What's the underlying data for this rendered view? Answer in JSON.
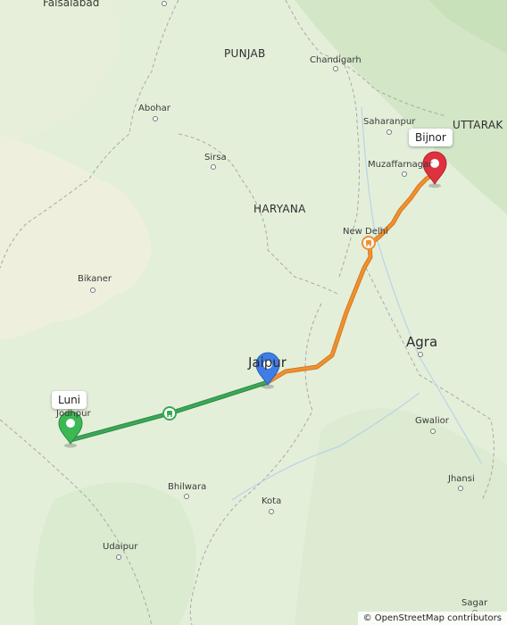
{
  "map": {
    "labels": {
      "faisalabad": "Faisalabad",
      "punjab": "PUNJAB",
      "chandigarh": "Chandigarh",
      "abohar": "Abohar",
      "saharanpur": "Saharanpur",
      "uttarakhand": "UTTARAK",
      "sirsa": "Sirsa",
      "muzaffarnagar": "Muzaffarnagar",
      "haryana": "HARYANA",
      "new_delhi": "New Delhi",
      "bikaner": "Bikaner",
      "agra": "Agra",
      "jaipur": "Jaipur",
      "jodhpur": "Jodhpur",
      "gwalior": "Gwalior",
      "bhilwara": "Bhilwara",
      "kota": "Kota",
      "jhansi": "Jhansi",
      "udaipur": "Udaipur",
      "sagar": "Sagar"
    },
    "markers": {
      "start": {
        "label": "Luni",
        "color": "#3db855"
      },
      "waypoint": {
        "color": "#3f7de6"
      },
      "end": {
        "label": "Bijnor",
        "color": "#e0313f"
      }
    },
    "routes": {
      "leg1_color": "#3aa856",
      "leg2_color": "#f0902f"
    },
    "icons": {
      "toll": "train-icon",
      "toll2": "train-icon"
    },
    "attribution": "© OpenStreetMap contributors"
  }
}
